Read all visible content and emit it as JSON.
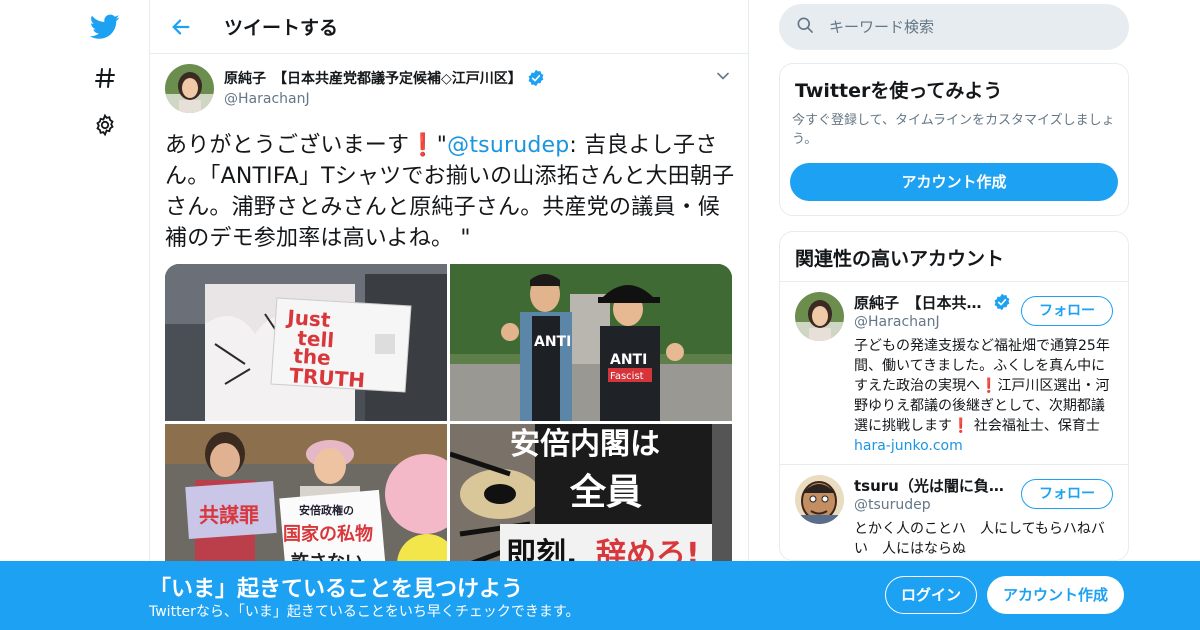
{
  "colors": {
    "brand": "#1da1f2",
    "link": "#1b95e0",
    "emoji_exclamation": "#e0245e",
    "muted": "#657786"
  },
  "nav": {
    "icons": [
      "twitter-logo-icon",
      "hashtag-icon",
      "gear-icon"
    ]
  },
  "header": {
    "title": "ツイートする"
  },
  "tweet": {
    "display_name": "原純子　【日本共産党都議予定候補◇江戸川区】",
    "handle": "@HarachanJ",
    "text_part1": "ありがとうございまーす",
    "exclamation": "❗",
    "text_quote_open": "\"",
    "mention": "@tsurudep",
    "text_part2": ": 吉良よし子さん。「ANTIFA」Tシャツでお揃いの山添拓さんと大田朝子さん。浦野さとみさんと原純子さん。共産党の議員・候補のデモ参加率は高いよね。 \"",
    "photos": {
      "p1_sign_words": [
        "Just",
        "tell",
        "the",
        "TRUTH"
      ],
      "p2_shirt": "ANTI",
      "p2_shirt_sub": "Fascist",
      "p3_sign": "共謀罪",
      "p3_sign2_top": "安倍政権の",
      "p3_sign2_mid": "国家の私物",
      "p3_sign2_bottom": "許さない",
      "p4_top": "安倍内閣は",
      "p4_mid": "全員",
      "p4_bottom_black": "即刻,",
      "p4_bottom_red": "辞めろ!"
    }
  },
  "search": {
    "placeholder": "キーワード検索"
  },
  "signup_card": {
    "title": "Twitterを使ってみよう",
    "desc": "今すぐ登録して、タイムラインをカスタマイズしましょう。",
    "button": "アカウント作成"
  },
  "related": {
    "title": "関連性の高いアカウント",
    "accounts": [
      {
        "name": "原純子　【日本共産党都議予定候補◇江戸川区】",
        "handle": "@HarachanJ",
        "follow": "フォロー",
        "bio_part1": "子どもの発達支援など福祉畑で通算25年間、働いてきました。ふくしを真ん中にすえた政治の実現へ",
        "bio_ex1": "❗",
        "bio_part2": "江戸川区選出・河野ゆりえ都議の後継ぎとして、次期都議選に挑戦します",
        "bio_ex2": "❗",
        "bio_part3": " 社会福祉士、保育士　",
        "bio_link": "hara-junko.com"
      },
      {
        "name": "tsuru（光は闇に負けない）",
        "handle": "@tsurudep",
        "follow": "フォロー",
        "bio": "とかく人のことハ　人にしてもらハねバい　人にはならぬ"
      }
    ]
  },
  "banner": {
    "title": "「いま」起きていることを見つけよう",
    "subtitle": "Twitterなら、「いま」起きていることをいち早くチェックできます。",
    "login": "ログイン",
    "signup": "アカウント作成"
  }
}
